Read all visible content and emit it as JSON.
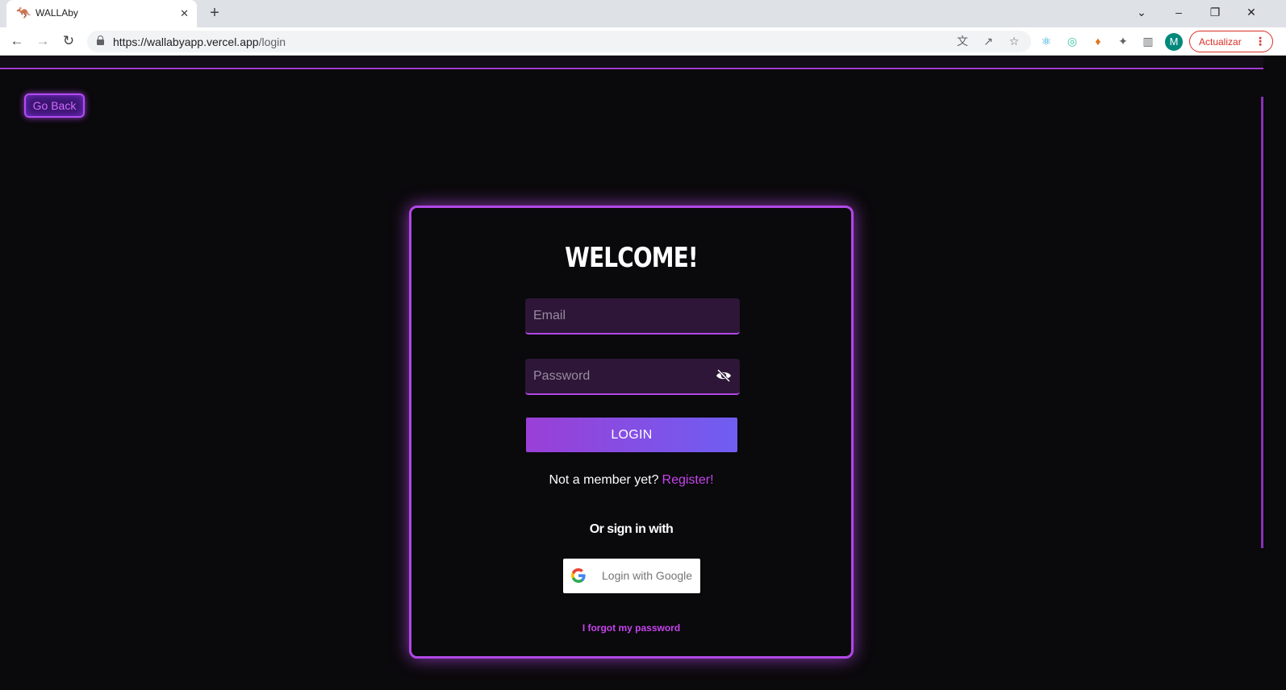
{
  "browser": {
    "tab_title": "WALLAby",
    "tab_favicon": "kangaroo-icon",
    "url_host": "https://wallabyapp.vercel.app",
    "url_path": "/login",
    "update_label": "Actualizar",
    "profile_initial": "M",
    "profile_color": "#00897b"
  },
  "page": {
    "go_back_label": "Go Back",
    "title": "WELCOME!",
    "email_placeholder": "Email",
    "password_placeholder": "Password",
    "login_label": "LOGIN",
    "register_prompt": "Not a member yet?",
    "register_link": "Register!",
    "or_sign_in": "Or sign in with",
    "google_label": "Login with Google",
    "forgot_label": "I forgot my password"
  },
  "colors": {
    "accent": "#b148e6",
    "background": "#0a090b",
    "button_gradient_start": "#9a3fd6",
    "button_gradient_end": "#6f5ef2"
  }
}
